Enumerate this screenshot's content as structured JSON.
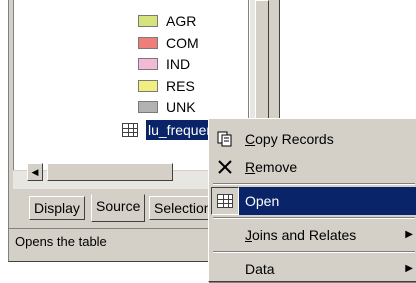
{
  "legend": [
    {
      "label": "AGR",
      "color": "#d7e37c"
    },
    {
      "label": "COM",
      "color": "#ef7e78"
    },
    {
      "label": "IND",
      "color": "#f4b9d6"
    },
    {
      "label": "RES",
      "color": "#f1ef7f"
    },
    {
      "label": "UNK",
      "color": "#b2b2b2"
    }
  ],
  "table": {
    "name": "lu_frequency",
    "icon": "table-icon"
  },
  "tabs": [
    {
      "label": "Display",
      "active": false
    },
    {
      "label": "Source",
      "active": true
    },
    {
      "label": "Selection",
      "active": false
    }
  ],
  "status": "Opens the table",
  "menu": {
    "copy": {
      "label": "Copy Records",
      "icon": "copy-icon"
    },
    "remove": {
      "label": "Remove",
      "icon": "x-remove-icon"
    },
    "open": {
      "label": "Open",
      "icon": "table-icon"
    },
    "joins": {
      "label": "Joins and Relates",
      "icon": "submenu-arrow-icon"
    },
    "data": {
      "label": "Data",
      "icon": "submenu-arrow-icon"
    }
  }
}
